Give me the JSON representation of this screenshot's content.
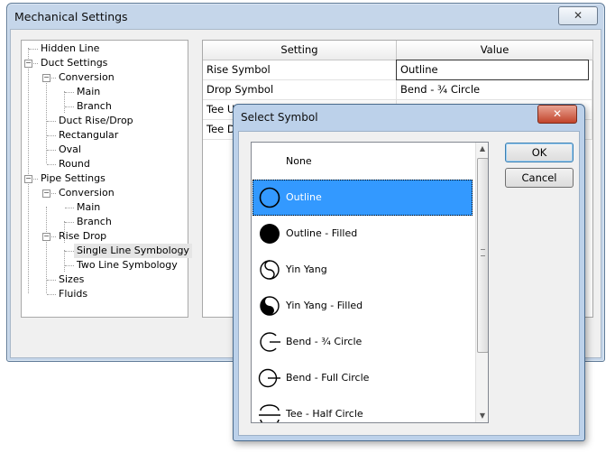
{
  "main_window": {
    "title": "Mechanical Settings",
    "close_label": "✕"
  },
  "tree": {
    "items": [
      {
        "label": "Hidden Line",
        "level": 0
      },
      {
        "label": "Duct Settings",
        "level": 0,
        "expander": "−"
      },
      {
        "label": "Conversion",
        "level": 1,
        "expander": "−"
      },
      {
        "label": "Main",
        "level": 2
      },
      {
        "label": "Branch",
        "level": 2
      },
      {
        "label": "Duct Rise/Drop",
        "level": 1
      },
      {
        "label": "Rectangular",
        "level": 1
      },
      {
        "label": "Oval",
        "level": 1
      },
      {
        "label": "Round",
        "level": 1
      },
      {
        "label": "Pipe Settings",
        "level": 0,
        "expander": "−"
      },
      {
        "label": "Conversion",
        "level": 1,
        "expander": "−"
      },
      {
        "label": "Main",
        "level": 2
      },
      {
        "label": "Branch",
        "level": 2
      },
      {
        "label": "Rise Drop",
        "level": 1,
        "expander": "−"
      },
      {
        "label": "Single Line Symbology",
        "level": 2,
        "selected": true
      },
      {
        "label": "Two Line Symbology",
        "level": 2
      },
      {
        "label": "Sizes",
        "level": 1
      },
      {
        "label": "Fluids",
        "level": 1
      }
    ]
  },
  "grid": {
    "headers": [
      "Setting",
      "Value"
    ],
    "rows": [
      {
        "setting": "Rise Symbol",
        "value": "Outline"
      },
      {
        "setting": "Drop Symbol",
        "value": "Bend - ¾ Circle"
      },
      {
        "setting": "Tee Up",
        "value": ""
      },
      {
        "setting": "Tee Do",
        "value": ""
      }
    ]
  },
  "dialog": {
    "title": "Select Symbol",
    "close_label": "✕",
    "ok_label": "OK",
    "cancel_label": "Cancel",
    "symbols": [
      {
        "label": "None",
        "icon": "none-icon"
      },
      {
        "label": "Outline",
        "icon": "outline-circle-icon",
        "selected": true
      },
      {
        "label": "Outline - Filled",
        "icon": "filled-circle-icon"
      },
      {
        "label": "Yin Yang",
        "icon": "yin-yang-icon"
      },
      {
        "label": "Yin Yang - Filled",
        "icon": "yin-yang-filled-icon"
      },
      {
        "label": "Bend - ¾ Circle",
        "icon": "bend-three-quarter-icon"
      },
      {
        "label": "Bend - Full Circle",
        "icon": "bend-full-circle-icon"
      },
      {
        "label": "Tee - Half Circle",
        "icon": "tee-half-circle-icon"
      }
    ]
  }
}
